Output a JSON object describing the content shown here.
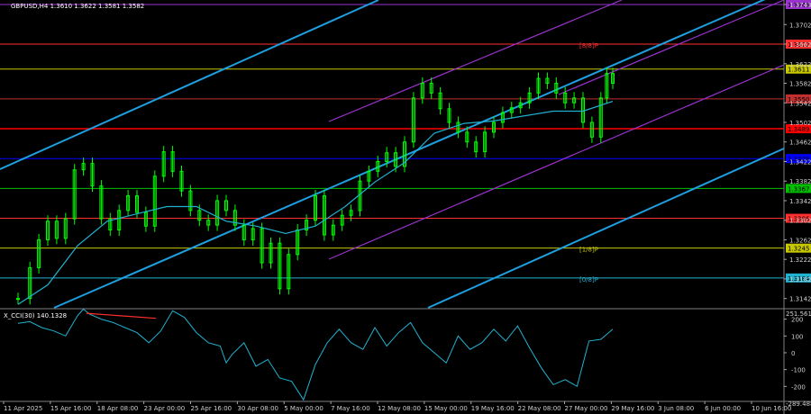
{
  "header": {
    "main_title": "GBPUSD,H4  1.3610 1.3622 1.3581 1.3582",
    "sub_title": "X_CCI(30) 140.1328",
    "sub_scale_top": "251.5616",
    "sub_scale_bottom": "-289.4889"
  },
  "colors": {
    "background": "#000000",
    "candle": "#00ff00",
    "ma": "#20b2d0",
    "channel_blue": "#1e9fe0",
    "channel_purple": "#9932cc",
    "red_level": "#ff0000",
    "yellow_level": "#c8c800",
    "cci": "#20b2d0",
    "divergence": "#ff3030"
  },
  "chart_data": [
    {
      "type": "line",
      "title": "GBPUSD,H4  1.3610 1.3622 1.3581 1.3582",
      "symbol": "GBPUSD",
      "timeframe": "H4",
      "ohlc_last": {
        "open": 1.361,
        "high": 1.3622,
        "low": 1.3581,
        "close": 1.3582
      },
      "ylim": [
        1.3123,
        1.3743
      ],
      "y_ticks": [
        "1.3743",
        "1.3702",
        "1.3662",
        "1.3622",
        "1.3582",
        "1.3542",
        "1.3502",
        "1.3462",
        "1.3422",
        "1.3382",
        "1.3342",
        "1.3302",
        "1.3262",
        "1.3222",
        "1.3182",
        "1.3142"
      ],
      "x_ticks": [
        "11 Apr 2025",
        "15 Apr 16:00",
        "18 Apr 08:00",
        "23 Apr 00:00",
        "25 Apr 16:00",
        "30 Apr 08:00",
        "5 May 00:00",
        "7 May 16:00",
        "12 May 08:00",
        "15 May 00:00",
        "19 May 16:00",
        "22 May 08:00",
        "27 May 00:00",
        "29 May 16:00",
        "3 Jun 08:00",
        "6 Jun 00:00",
        "10 Jun 16:00"
      ],
      "series": [
        {
          "role": "price",
          "x_frac": [
            0,
            0.02,
            0.035,
            0.05,
            0.065,
            0.08,
            0.095,
            0.11,
            0.125,
            0.14,
            0.155,
            0.17,
            0.185,
            0.2,
            0.215,
            0.23,
            0.245,
            0.26,
            0.275,
            0.29,
            0.305,
            0.32,
            0.335,
            0.35,
            0.365,
            0.38,
            0.395,
            0.41,
            0.425,
            0.44,
            0.455,
            0.47,
            0.485,
            0.5,
            0.515,
            0.53,
            0.545,
            0.56,
            0.575,
            0.59,
            0.605,
            0.62,
            0.635,
            0.65,
            0.665,
            0.68,
            0.695,
            0.71,
            0.725,
            0.74,
            0.755,
            0.77,
            0.785,
            0.8,
            0.815,
            0.83,
            0.845,
            0.86,
            0.875,
            0.89,
            0.905,
            0.92,
            0.935,
            0.95,
            0.965,
            0.98,
            0.99,
            1.0
          ],
          "values": [
            1.3142,
            1.3205,
            1.3262,
            1.33,
            1.3265,
            1.3305,
            1.3405,
            1.3418,
            1.3372,
            1.3305,
            1.3282,
            1.3322,
            1.3352,
            1.3318,
            1.329,
            1.3392,
            1.3442,
            1.3402,
            1.3362,
            1.3322,
            1.3302,
            1.3292,
            1.3342,
            1.3322,
            1.3292,
            1.3262,
            1.3285,
            1.3215,
            1.3255,
            1.3162,
            1.3232,
            1.3282,
            1.3302,
            1.3352,
            1.3272,
            1.3292,
            1.3312,
            1.3322,
            1.3382,
            1.3402,
            1.3422,
            1.344,
            1.3412,
            1.3462,
            1.3552,
            1.3582,
            1.3562,
            1.353,
            1.3502,
            1.3482,
            1.3462,
            1.3442,
            1.3482,
            1.3502,
            1.3522,
            1.3532,
            1.3542,
            1.3562,
            1.3592,
            1.3582,
            1.3562,
            1.3542,
            1.3552,
            1.3502,
            1.3472,
            1.3552,
            1.3602,
            1.3582
          ]
        },
        {
          "role": "moving_average",
          "x_frac": [
            0,
            0.05,
            0.1,
            0.15,
            0.2,
            0.25,
            0.3,
            0.35,
            0.4,
            0.45,
            0.5,
            0.55,
            0.6,
            0.65,
            0.7,
            0.75,
            0.8,
            0.85,
            0.9,
            0.95,
            1.0
          ],
          "values": [
            1.313,
            1.317,
            1.325,
            1.33,
            1.3315,
            1.333,
            1.333,
            1.33,
            1.329,
            1.3275,
            1.329,
            1.333,
            1.338,
            1.342,
            1.348,
            1.35,
            1.3505,
            1.3515,
            1.3525,
            1.3525,
            1.3545
          ]
        }
      ],
      "levels": [
        {
          "price": 1.3743,
          "label": "1.3743",
          "tag": "",
          "color": "#9932cc"
        },
        {
          "price": 1.3662,
          "label": "1.3672",
          "tag": "[8/8]P",
          "color": "#ff3030"
        },
        {
          "price": 1.3611,
          "label": "1.3611",
          "tag": "",
          "color": "#c8c800"
        },
        {
          "price": 1.355,
          "label": "1.3550",
          "tag": "",
          "color": "#c03030"
        },
        {
          "price": 1.3489,
          "label": "1.3489",
          "tag": "",
          "color": "#ff0000"
        },
        {
          "price": 1.3428,
          "label": "1.3428",
          "tag": "",
          "color": "#0000ff"
        },
        {
          "price": 1.3367,
          "label": "1.3367",
          "tag": "",
          "color": "#00c000"
        },
        {
          "price": 1.3306,
          "label": "1.3306",
          "tag": "",
          "color": "#ff3030"
        },
        {
          "price": 1.3245,
          "label": "1.3245",
          "tag": "[1/8]P",
          "color": "#c8c800"
        },
        {
          "price": 1.3184,
          "label": "1.3184",
          "tag": "[0/8]P",
          "color": "#20b2d0"
        }
      ]
    },
    {
      "type": "line",
      "title": "X_CCI(30) 140.1328",
      "ylim": [
        -289.4889,
        251.5616
      ],
      "y_ticks": [
        "251.5616",
        "200",
        "100",
        "0",
        "-100",
        "-200",
        "-289.4889"
      ],
      "series": [
        {
          "role": "cci",
          "x_frac": [
            0,
            0.02,
            0.04,
            0.06,
            0.08,
            0.1,
            0.11,
            0.12,
            0.14,
            0.16,
            0.18,
            0.2,
            0.22,
            0.24,
            0.26,
            0.28,
            0.3,
            0.32,
            0.34,
            0.35,
            0.36,
            0.38,
            0.4,
            0.42,
            0.44,
            0.46,
            0.48,
            0.5,
            0.52,
            0.54,
            0.56,
            0.58,
            0.6,
            0.62,
            0.64,
            0.66,
            0.68,
            0.7,
            0.72,
            0.74,
            0.76,
            0.78,
            0.8,
            0.82,
            0.84,
            0.86,
            0.88,
            0.9,
            0.92,
            0.94,
            0.96,
            0.98,
            1.0
          ],
          "values": [
            175,
            185,
            150,
            130,
            100,
            220,
            260,
            230,
            200,
            180,
            150,
            120,
            60,
            130,
            250,
            210,
            120,
            60,
            40,
            -60,
            -10,
            60,
            -80,
            -40,
            -150,
            -170,
            -280,
            -70,
            60,
            140,
            60,
            20,
            150,
            40,
            120,
            180,
            60,
            0,
            -60,
            100,
            20,
            60,
            140,
            70,
            160,
            30,
            -90,
            -190,
            -160,
            -200,
            70,
            80,
            140
          ]
        }
      ],
      "divergence_line": {
        "from_x_frac": 0.115,
        "from_value": 235,
        "to_x_frac": 0.232,
        "to_value": 205
      }
    }
  ]
}
